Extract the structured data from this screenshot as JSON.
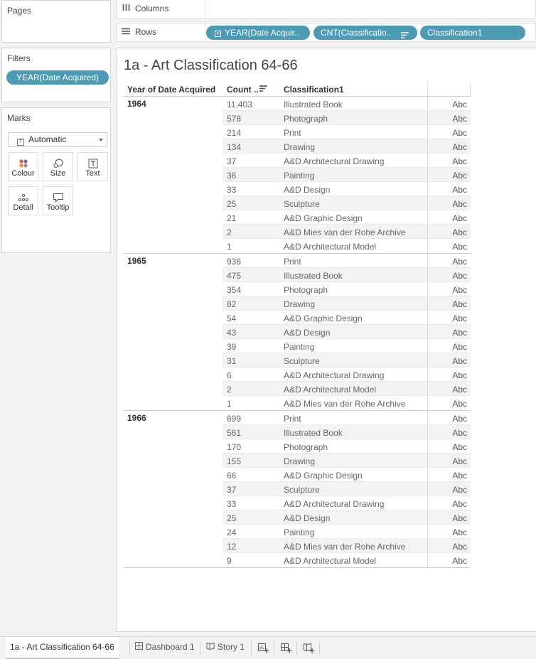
{
  "panels": {
    "pages_title": "Pages",
    "filters_title": "Filters",
    "filter_pill": "YEAR(Date Acquired)",
    "marks_title": "Marks",
    "mark_type": "Automatic",
    "mark_type_icon": "T",
    "mark_cards": [
      "Colour",
      "Size",
      "Text",
      "Detail",
      "Tooltip"
    ]
  },
  "shelves": {
    "columns_label": "Columns",
    "rows_label": "Rows",
    "row_pills": [
      "YEAR(Date Acquir..",
      "CNT(Classificatio..",
      "Classification1"
    ]
  },
  "view": {
    "title": "1a - Art Classification 64-66",
    "headers": [
      "Year of Date Acquired",
      "Count ..",
      "Classification1"
    ]
  },
  "table": [
    {
      "year": "1964",
      "rows": [
        {
          "count": "11,403",
          "cls": "Illustrated Book"
        },
        {
          "count": "578",
          "cls": "Photograph"
        },
        {
          "count": "214",
          "cls": "Print"
        },
        {
          "count": "134",
          "cls": "Drawing"
        },
        {
          "count": "37",
          "cls": "A&D Architectural Drawing"
        },
        {
          "count": "36",
          "cls": "Painting"
        },
        {
          "count": "33",
          "cls": "A&D Design"
        },
        {
          "count": "25",
          "cls": "Sculpture"
        },
        {
          "count": "21",
          "cls": "A&D Graphic Design"
        },
        {
          "count": "2",
          "cls": "A&D Mies van der Rohe Archive"
        },
        {
          "count": "1",
          "cls": "A&D Architectural Model"
        }
      ]
    },
    {
      "year": "1965",
      "rows": [
        {
          "count": "936",
          "cls": "Print"
        },
        {
          "count": "475",
          "cls": "Illustrated Book"
        },
        {
          "count": "354",
          "cls": "Photograph"
        },
        {
          "count": "82",
          "cls": "Drawing"
        },
        {
          "count": "54",
          "cls": "A&D Graphic Design"
        },
        {
          "count": "43",
          "cls": "A&D Design"
        },
        {
          "count": "39",
          "cls": "Painting"
        },
        {
          "count": "31",
          "cls": "Sculpture"
        },
        {
          "count": "6",
          "cls": "A&D Architectural Drawing"
        },
        {
          "count": "2",
          "cls": "A&D Architectural Model"
        },
        {
          "count": "1",
          "cls": "A&D Mies van der Rohe Archive"
        }
      ]
    },
    {
      "year": "1966",
      "rows": [
        {
          "count": "699",
          "cls": "Print"
        },
        {
          "count": "561",
          "cls": "Illustrated Book"
        },
        {
          "count": "170",
          "cls": "Photograph"
        },
        {
          "count": "155",
          "cls": "Drawing"
        },
        {
          "count": "66",
          "cls": "A&D Graphic Design"
        },
        {
          "count": "37",
          "cls": "Sculpture"
        },
        {
          "count": "33",
          "cls": "A&D Architectural Drawing"
        },
        {
          "count": "25",
          "cls": "A&D Design"
        },
        {
          "count": "24",
          "cls": "Painting"
        },
        {
          "count": "12",
          "cls": "A&D Mies van der Rohe Archive"
        },
        {
          "count": "9",
          "cls": "A&D Architectural Model"
        }
      ]
    }
  ],
  "cell_marker": "Abc",
  "tabs": [
    "1a - Art Classification 64-66",
    "Dashboard 1",
    "Story 1"
  ],
  "colors": {
    "pill": "#4a9bb3",
    "row_alt": "#f3f3f3"
  }
}
